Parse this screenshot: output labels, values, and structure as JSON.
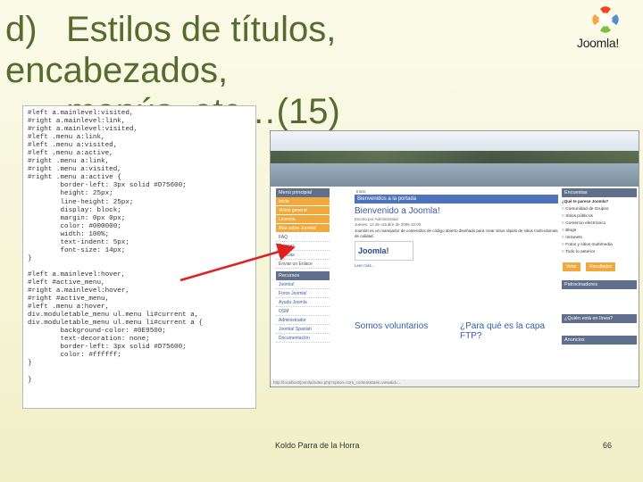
{
  "slide": {
    "letter": "d)",
    "title_line1": "Estilos de títulos, encabezados,",
    "title_line2": "menús, etc…(15)"
  },
  "logo": {
    "text": "Joomla!"
  },
  "code_lines": [
    "#left a.mainlevel:visited,",
    "#right a.mainlevel:link,",
    "#right a.mainlevel:visited,",
    "#left .menu a:link,",
    "#left .menu a:visited,",
    "#left .menu a:active,",
    "#right .menu a:link,",
    "#right .menu a:visited,",
    "#right .menu a:active {",
    "        border-left: 3px solid #D75600;",
    "        height: 25px;",
    "        line-height: 25px;",
    "        display: block;",
    "        margin: 0px 0px;",
    "        color: #000000;",
    "        width: 100%;",
    "        text-indent: 5px;",
    "        font-size: 14px;",
    "}",
    "",
    "#left a.mainlevel:hover,",
    "#left #active_menu,",
    "#right a.mainlevel:hover,",
    "#right #active_menu,",
    "#left .menu a:hover,",
    "div.moduletable_menu ul.menu li#current a,",
    "div.moduletable_menu ul.menu li#current a {",
    "        background-color: #0E9500;",
    "        text-decoration: none;",
    "        border-left: 3px solid #D75600;",
    "        color: #ffffff;",
    "}",
    "",
    "}"
  ],
  "screenshot": {
    "main_menu_title": "Menú principial",
    "main_menu": [
      "Inicio",
      "Visión general",
      "Licencia",
      "Más sobre Joomla!",
      "FAQ",
      "Enlaces",
      "Noticias",
      "Enviar un Enlace"
    ],
    "resources_title": "Recursos",
    "resources": [
      "Joomla!",
      "Foros Joomla!",
      "Ayuda Joomla",
      "OSM",
      "Administrador",
      "Joomla! Spanish",
      "Documentación"
    ],
    "nav_tag": "Inicio",
    "tab_label": "Bienvenidos a la portada",
    "article_title": "Bienvenido a Joomla!",
    "article_meta": "Escrito por Administrator\nJueves, 12 de octubre de 2006 10:00",
    "article_text": "Joomla! es un manejador de contenidos de código abierto diseñado para crear sitios rápido de sitios multi-idiomas de calidad.",
    "badge": "Joomla!",
    "more_label": "Leer más...",
    "article2_title": "Somos voluntarios",
    "article3_title": "¿Para qué es la capa FTP?",
    "polls_title": "Encuestas",
    "poll_question": "¿Qué te parece Joomla?",
    "poll_options": [
      "Comunidad de Grupos",
      "Sitios públicos",
      "Comercio electrónico",
      "Blogs",
      "Intranets",
      "Fotos y sitios multimedia",
      "Todo lo anterior"
    ],
    "vote_label": "Votar",
    "results_label": "Resultados",
    "sponsors_title": "Patrocinadores",
    "online_title": "¿Quién está en línea?",
    "ads_title": "Anuncios",
    "url": "http://localhost/joomla/index.php?option=com_content&task=view&id=..."
  },
  "footer": {
    "author": "Koldo Parra de la Horra",
    "page": "66"
  }
}
